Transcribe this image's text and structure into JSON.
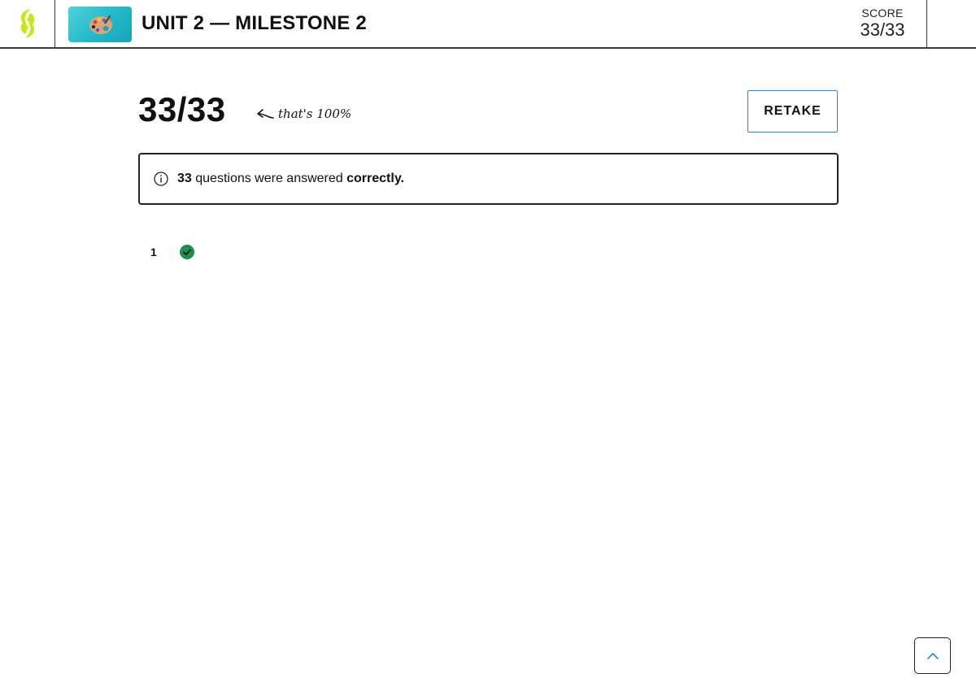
{
  "header": {
    "title": "UNIT 2 — MILESTONE 2",
    "score_label": "SCORE",
    "score_value": "33/33",
    "logo_color": "#c8e619",
    "thumbnail_icon": "art-palette-icon"
  },
  "result": {
    "score": "33/33",
    "annotation": "that's 100%",
    "percent_correct": 100,
    "retake_label": "RETAKE",
    "accent_color": "#2a86d8"
  },
  "notice": {
    "count": "33",
    "text_middle": " questions were answered ",
    "text_emphasis": "correctly."
  },
  "questions": [
    {
      "number": "1",
      "status": "correct",
      "status_color": "#1f8f4e"
    }
  ],
  "scroll_top_icon": "chevron-up-icon"
}
